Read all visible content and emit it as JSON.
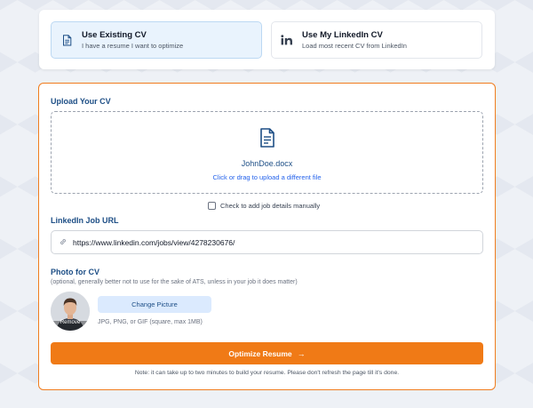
{
  "source_options": [
    {
      "title": "Use Existing CV",
      "subtitle": "I have a resume I want to optimize",
      "icon": "document-icon",
      "selected": true
    },
    {
      "title": "Use My LinkedIn CV",
      "subtitle": "Load most recent CV from LinkedIn",
      "icon": "linkedin-icon",
      "selected": false
    }
  ],
  "upload": {
    "label": "Upload Your CV",
    "file_name": "JohnDoe.docx",
    "hint": "Click or drag to upload a different file",
    "icon": "document-icon"
  },
  "manual_details": {
    "label": "Check to add job details manually",
    "checked": false
  },
  "linkedin_job": {
    "label": "LinkedIn Job URL",
    "value": "https://www.linkedin.com/jobs/view/4278230676/",
    "icon": "link-icon"
  },
  "photo": {
    "label": "Photo for CV",
    "hint": "(optional, generally better not to use for the sake of ATS, unless in your job it does matter)",
    "remove_label": "Remove",
    "change_label": "Change Picture",
    "file_types": "JPG, PNG, or GIF (square, max 1MB)"
  },
  "submit": {
    "label": "Optimize Resume",
    "arrow": "→"
  },
  "note": "Note: it can take up to two minutes to build your resume. Please don't refresh the page till it's done.",
  "colors": {
    "accent": "#f07a16",
    "heading": "#1e4f86",
    "link": "#2563eb",
    "selected_bg": "#e9f3fd"
  }
}
